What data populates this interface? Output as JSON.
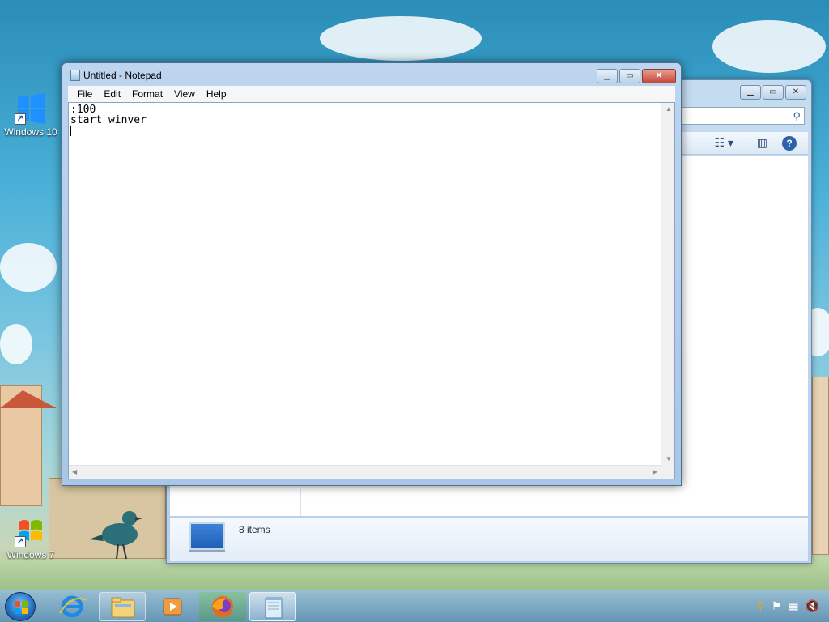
{
  "desktop": {
    "icons": [
      {
        "label": "Windows 10",
        "icon": "windows10-shortcut-icon"
      },
      {
        "label": "Windows 7",
        "icon": "windows7-shortcut-icon"
      }
    ]
  },
  "explorer": {
    "status_count": "8 items",
    "icons": [
      "search-icon",
      "view-options-icon",
      "preview-pane-icon",
      "help-icon"
    ]
  },
  "notepad": {
    "title": "Untitled - Notepad",
    "menu": [
      "File",
      "Edit",
      "Format",
      "View",
      "Help"
    ],
    "content_lines": [
      ":100",
      "start winver",
      ""
    ]
  },
  "taskbar": {
    "items": [
      {
        "name": "internet-explorer",
        "state": "pinned"
      },
      {
        "name": "file-explorer",
        "state": "open"
      },
      {
        "name": "media-player",
        "state": "pinned"
      },
      {
        "name": "firefox",
        "state": "pinned"
      },
      {
        "name": "notepad",
        "state": "active"
      }
    ],
    "tray": [
      "search-tray-icon",
      "action-center-flag-icon",
      "network-icon",
      "volume-muted-icon"
    ]
  },
  "colors": {
    "titlebar": "#bdd5ee",
    "close_button": "#c5473a",
    "taskbar": "#6294be"
  }
}
